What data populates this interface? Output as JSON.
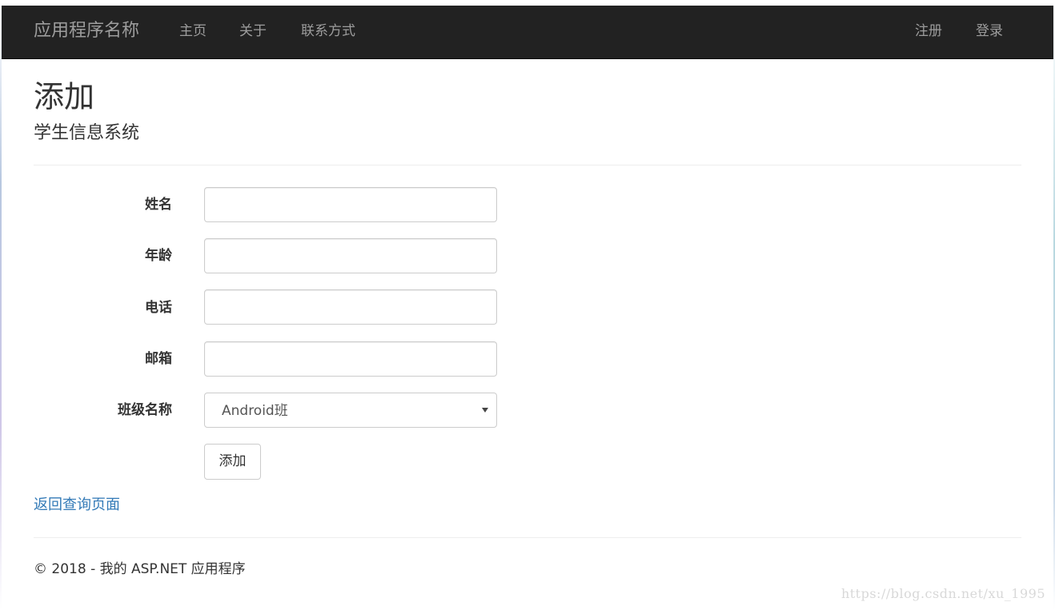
{
  "navbar": {
    "brand": "应用程序名称",
    "left_links": [
      "主页",
      "关于",
      "联系方式"
    ],
    "right_links": [
      "注册",
      "登录"
    ],
    "background_color": "#222222",
    "link_color": "#9d9d9d"
  },
  "header": {
    "title": "添加",
    "subtitle": "学生信息系统"
  },
  "form": {
    "fields": [
      {
        "label": "姓名",
        "value": ""
      },
      {
        "label": "年龄",
        "value": ""
      },
      {
        "label": "电话",
        "value": ""
      },
      {
        "label": "邮箱",
        "value": ""
      }
    ],
    "class_field": {
      "label": "班级名称",
      "selected": "Android班"
    },
    "submit_label": "添加"
  },
  "back_link": "返回查询页面",
  "link_color": "#337ab7",
  "footer": "© 2018 - 我的 ASP.NET 应用程序",
  "watermark": "https://blog.csdn.net/xu_1995"
}
